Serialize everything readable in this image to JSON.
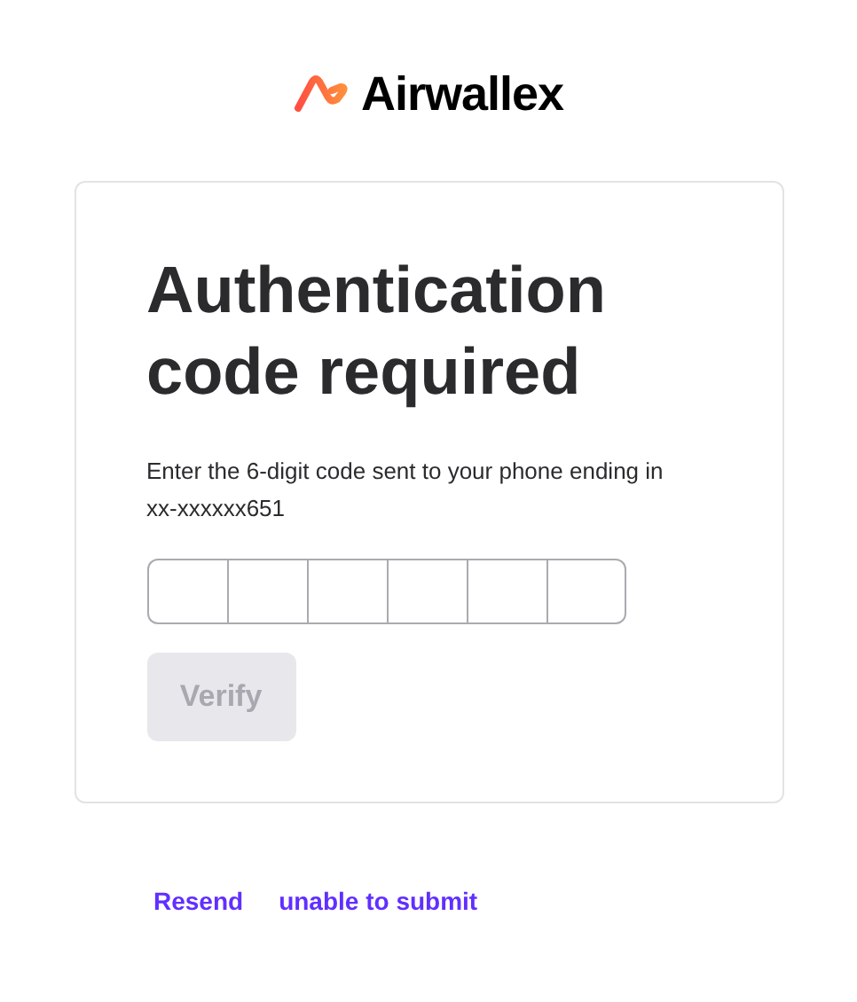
{
  "logo": {
    "text": "Airwallex"
  },
  "card": {
    "title": "Authentication code required",
    "instruction": "Enter the 6-digit code sent to your phone ending in xx-xxxxxx651",
    "verify_button": {
      "label": "Verify",
      "disabled": true
    }
  },
  "links": [
    "Resend",
    "unable to submit"
  ]
}
